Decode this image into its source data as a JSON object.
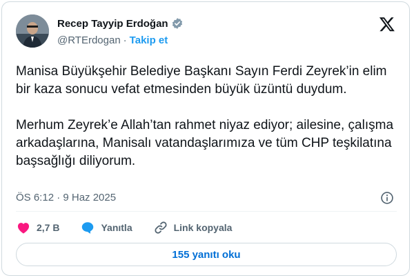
{
  "author": {
    "name": "Recep Tayyip Erdoğan",
    "handle": "@RTErdogan",
    "separator": "·",
    "follow_label": "Takip et"
  },
  "tweet": {
    "text": "Manisa Büyükşehir Belediye Başkanı Sayın Ferdi Zeyrek’in elim bir kaza sonucu vefat etmesinden büyük üzüntü duydum.\n\nMerhum Zeyrek’e Allah’tan rahmet niyaz ediyor; ailesine, çalışma arkadaşlarına, Manisalı vatandaşlarımıza ve tüm CHP teşkilatına başsağlığı diliyorum.",
    "timestamp": "ÖS 6:12 · 9 Haz 2025"
  },
  "actions": {
    "likes": "2,7 B",
    "reply_label": "Yanıtla",
    "copy_link_label": "Link kopyala"
  },
  "replies_button": "155 yanıtı oku",
  "colors": {
    "accent": "#1d9bf0",
    "like": "#f91880",
    "muted": "#536471",
    "border": "#cfd9de"
  },
  "icons": [
    "verified-badge-icon",
    "x-logo-icon",
    "info-icon",
    "heart-icon",
    "reply-bubble-icon",
    "link-icon"
  ]
}
